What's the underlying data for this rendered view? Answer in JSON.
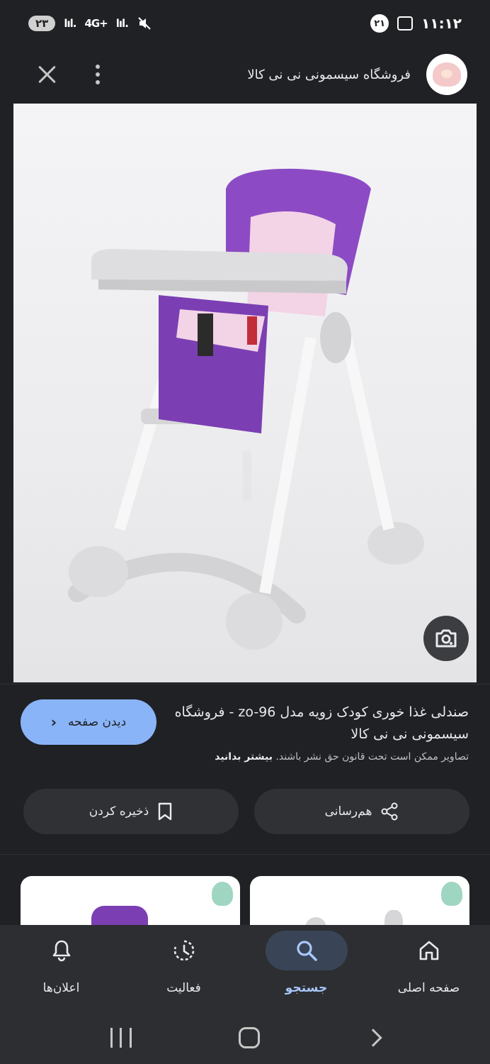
{
  "status_bar": {
    "time": "۱۱:۱۲",
    "notification_count": "۲۱",
    "battery": "۲۳",
    "network": "4G+"
  },
  "header": {
    "title": "فروشگاه سیسمونی نی نی کالا"
  },
  "caption": {
    "title": "صندلی غذا خوری کودک زویه مدل zo-96 - فروشگاه سیسمونی نی نی کالا",
    "visit_label": "دیدن صفحه",
    "copyright_note": "تصاویر ممکن است تحت قانون حق نشر باشند.",
    "learn_more": "بیشتر بدانید",
    "share_label": "هم‌رسانی",
    "save_label": "ذخیره کردن"
  },
  "bottom_nav": {
    "items": [
      {
        "label": "اعلان‌ها",
        "icon": "bell-icon"
      },
      {
        "label": "فعالیت",
        "icon": "history-icon"
      },
      {
        "label": "جستجو",
        "icon": "search-icon",
        "active": true
      },
      {
        "label": "صفحه اصلی",
        "icon": "home-icon"
      }
    ]
  },
  "colors": {
    "background": "#202124",
    "accent": "#8ab4f8",
    "active_nav": "#a8c7fa",
    "chair_purple": "#7b3fb3"
  }
}
